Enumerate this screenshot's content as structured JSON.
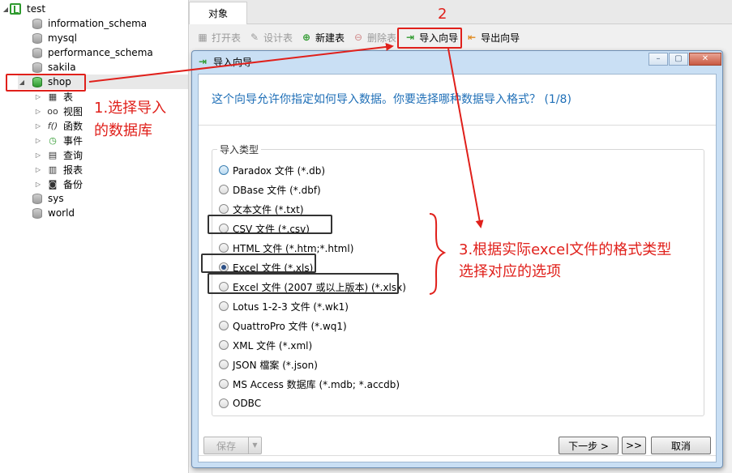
{
  "tree": {
    "connection": "test",
    "databases": [
      "information_schema",
      "mysql",
      "performance_schema",
      "sakila",
      "shop"
    ],
    "objects": [
      {
        "label": "表",
        "icon": "table-icon"
      },
      {
        "label": "视图",
        "icon": "view-icon"
      },
      {
        "label": "函数",
        "icon": "function-icon"
      },
      {
        "label": "事件",
        "icon": "event-icon"
      },
      {
        "label": "查询",
        "icon": "query-icon"
      },
      {
        "label": "报表",
        "icon": "report-icon"
      },
      {
        "label": "备份",
        "icon": "backup-icon"
      }
    ],
    "databases_after": [
      "sys",
      "world"
    ]
  },
  "tab": {
    "label": "对象"
  },
  "toolbar": {
    "open_table": "打开表",
    "design_table": "设计表",
    "new_table": "新建表",
    "delete_table": "删除表",
    "import_wizard": "导入向导",
    "export_wizard": "导出向导"
  },
  "dialog": {
    "title": "导入向导",
    "heading": "这个向导允许你指定如何导入数据。你要选择哪种数据导入格式？ (1/8)",
    "group_label": "导入类型",
    "options": [
      "Paradox 文件 (*.db)",
      "DBase 文件 (*.dbf)",
      "文本文件 (*.txt)",
      "CSV 文件 (*.csv)",
      "HTML 文件 (*.htm;*.html)",
      "Excel 文件 (*.xls)",
      "Excel 文件 (2007 或以上版本) (*.xlsx)",
      "Lotus 1-2-3 文件 (*.wk1)",
      "QuattroPro 文件 (*.wq1)",
      "XML 文件 (*.xml)",
      "JSON 檔案 (*.json)",
      "MS Access 数据库 (*.mdb; *.accdb)",
      "ODBC"
    ],
    "selected_option": "Excel 文件 (*.xls)",
    "save_button": "保存",
    "next_button": "下一步 >",
    "skip_button": ">>",
    "cancel_button": "取消"
  },
  "annotations": {
    "step1_line1": "1.选择导入",
    "step1_line2": "的数据库",
    "step2": "2",
    "step3_line1": "3.根据实际excel文件的格式类型",
    "step3_line2": "选择对应的选项"
  },
  "colors": {
    "annotation_red": "#e0201b",
    "heading_blue": "#1f6fb7",
    "dialog_frame": "#c9dff4"
  }
}
